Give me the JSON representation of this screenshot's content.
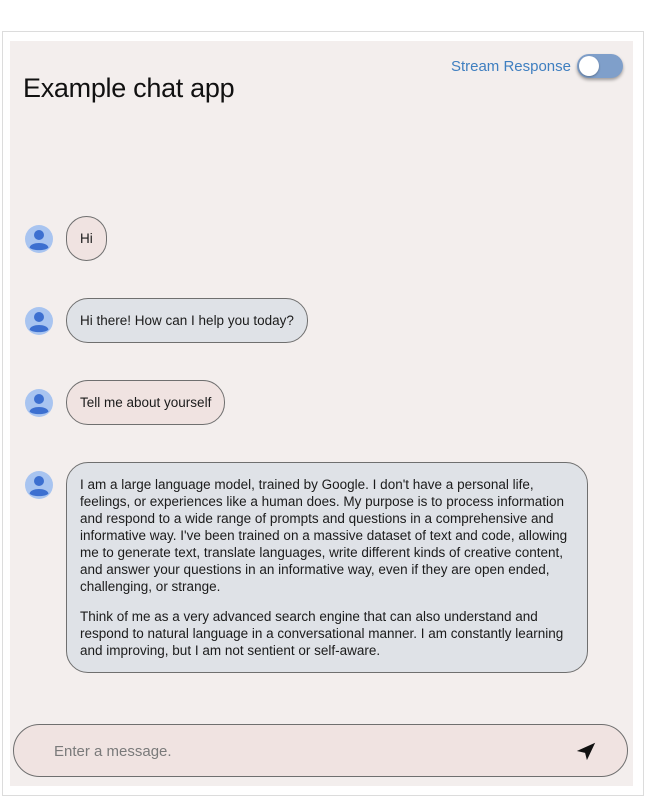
{
  "header": {
    "title": "Example chat app",
    "stream_label": "Stream Response",
    "stream_enabled": false
  },
  "messages": [
    {
      "role": "user",
      "paragraphs": [
        "Hi"
      ]
    },
    {
      "role": "model",
      "paragraphs": [
        "Hi there! How can I help you today?"
      ]
    },
    {
      "role": "user",
      "paragraphs": [
        "Tell me about yourself"
      ]
    },
    {
      "role": "model",
      "paragraphs": [
        "I am a large language model, trained by Google. I don't have a personal life, feelings, or experiences like a human does. My purpose is to process information and respond to a wide range of prompts and questions in a comprehensive and informative way. I've been trained on a massive dataset of text and code, allowing me to generate text, translate languages, write different kinds of creative content, and answer your questions in an informative way, even if they are open ended, challenging, or strange.",
        "Think of me as a very advanced search engine that can also understand and respond to natural language in a conversational manner. I am constantly learning and improving, but I am not sentient or self-aware."
      ]
    }
  ],
  "composer": {
    "placeholder": "Enter a message.",
    "value": ""
  },
  "icons": {
    "avatar": "person-avatar-icon",
    "send": "send-icon",
    "toggle": "toggle-switch"
  },
  "colors": {
    "app_background": "#f3eeed",
    "user_bubble": "#f0e3e1",
    "model_bubble": "#dfe2e7",
    "avatar": "#4f7fd8",
    "link": "#3f7fc0",
    "toggle_track": "#7f9fca"
  }
}
